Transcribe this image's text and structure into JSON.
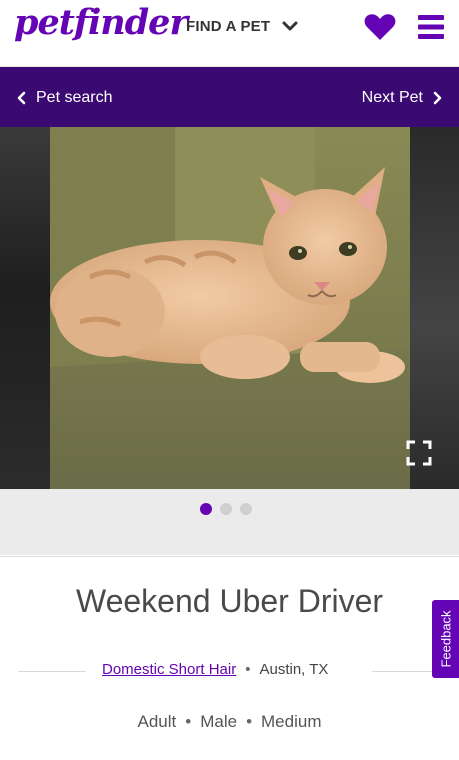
{
  "header": {
    "logo": "petfinder",
    "find_pet_label": "FIND A PET"
  },
  "nav": {
    "back_label": "Pet search",
    "next_label": "Next Pet"
  },
  "carousel": {
    "total_photos": 3,
    "active_index": 0
  },
  "pet": {
    "name": "Weekend Uber Driver",
    "breed": "Domestic Short Hair",
    "location": "Austin, TX",
    "age": "Adult",
    "sex": "Male",
    "size": "Medium"
  },
  "feedback_label": "Feedback",
  "colors": {
    "brand_purple": "#6504b5",
    "nav_purple": "#3a0a72",
    "dot_inactive": "#cfcfcf"
  },
  "icons": [
    "chevron-down-icon",
    "heart-icon",
    "hamburger-menu-icon",
    "chevron-left-icon",
    "chevron-right-icon",
    "expand-icon"
  ]
}
